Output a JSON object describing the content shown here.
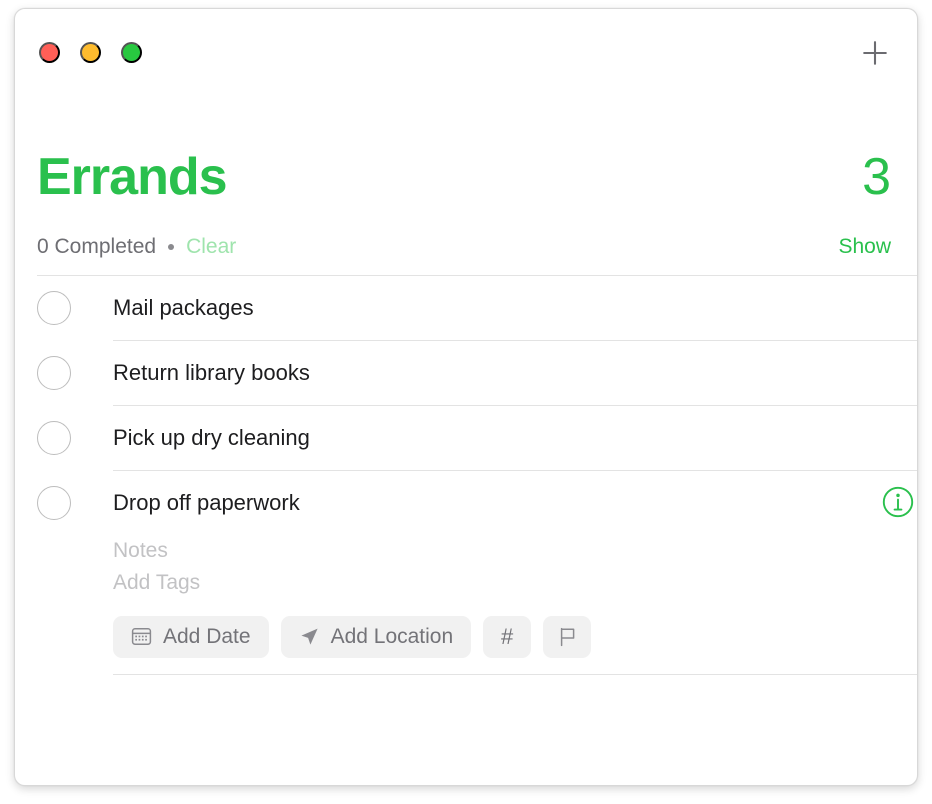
{
  "window": {
    "titlebar": {
      "traffic_lights": [
        {
          "name": "close",
          "color": "#ff5f57"
        },
        {
          "name": "minimize",
          "color": "#febc2e"
        },
        {
          "name": "maximize",
          "color": "#28c840"
        }
      ],
      "add_icon": "plus-icon"
    }
  },
  "header": {
    "title": "Errands",
    "count": "3",
    "accent_color": "#2ac04d"
  },
  "status": {
    "completed_label": "0 Completed",
    "separator": "•",
    "clear_label": "Clear",
    "clear_color": "#9fe4ad",
    "show_label": "Show",
    "show_color": "#2ac04d"
  },
  "tasks": [
    {
      "title": "Mail packages",
      "completed": false,
      "expanded": false
    },
    {
      "title": "Return library books",
      "completed": false,
      "expanded": false
    },
    {
      "title": "Pick up dry cleaning",
      "completed": false,
      "expanded": false
    },
    {
      "title": "Drop off paperwork",
      "completed": false,
      "expanded": true
    }
  ],
  "detail": {
    "notes_placeholder": "Notes",
    "tags_placeholder": "Add Tags",
    "info_icon": "info-circle-icon",
    "actions": [
      {
        "label": "Add Date",
        "icon": "calendar-icon"
      },
      {
        "label": "Add Location",
        "icon": "navigation-arrow-icon"
      },
      {
        "label": "#",
        "icon": "hashtag-icon"
      },
      {
        "label": "",
        "icon": "flag-icon"
      }
    ]
  }
}
